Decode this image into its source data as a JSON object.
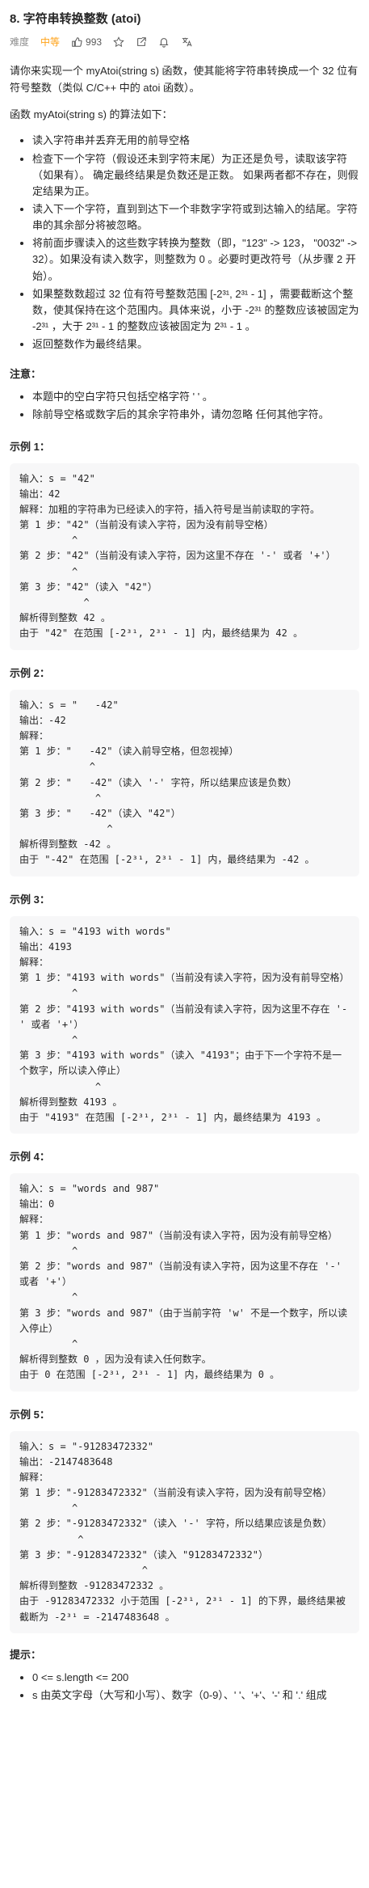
{
  "header": {
    "title": "8. 字符串转换整数 (atoi)",
    "difficulty_label": "难度",
    "difficulty": "中等",
    "likes": "993"
  },
  "intro": {
    "p1": "请你来实现一个 myAtoi(string s) 函数，使其能将字符串转换成一个 32 位有符号整数（类似 C/C++ 中的 atoi 函数）。",
    "p2": "函数 myAtoi(string s) 的算法如下：",
    "steps": [
      "读入字符串并丢弃无用的前导空格",
      "检查下一个字符（假设还未到字符末尾）为正还是负号，读取该字符（如果有）。 确定最终结果是负数还是正数。 如果两者都不存在，则假定结果为正。",
      "读入下一个字符，直到到达下一个非数字字符或到达输入的结尾。字符串的其余部分将被忽略。",
      "将前面步骤读入的这些数字转换为整数（即，\"123\" -> 123， \"0032\" -> 32）。如果没有读入数字，则整数为 0 。必要时更改符号（从步骤 2 开始）。",
      "如果整数数超过 32 位有符号整数范围 [-2³¹, 2³¹ - 1] ，需要截断这个整数，使其保持在这个范围内。具体来说，小于 -2³¹ 的整数应该被固定为 -2³¹ ，大于 2³¹ - 1 的整数应该被固定为 2³¹ - 1 。",
      "返回整数作为最终结果。"
    ]
  },
  "notes": {
    "heading": "注意：",
    "items": [
      "本题中的空白字符只包括空格字符 ' ' 。",
      "除前导空格或数字后的其余字符串外，请勿忽略 任何其他字符。"
    ]
  },
  "examples": [
    {
      "heading": "示例 1：",
      "lines": [
        "输入：s = \"42\"",
        "输出：42",
        "解释：加粗的字符串为已经读入的字符，插入符号是当前读取的字符。",
        "第 1 步：\"42\"（当前没有读入字符，因为没有前导空格）",
        "         ^",
        "第 2 步：\"42\"（当前没有读入字符，因为这里不存在 '-' 或者 '+'）",
        "         ^",
        "第 3 步：\"42\"（读入 \"42\"）",
        "           ^",
        "解析得到整数 42 。",
        "由于 \"42\" 在范围 [-2³¹, 2³¹ - 1] 内，最终结果为 42 。"
      ]
    },
    {
      "heading": "示例 2：",
      "lines": [
        "输入：s = \"   -42\"",
        "输出：-42",
        "解释：",
        "第 1 步：\"   -42\"（读入前导空格，但忽视掉）",
        "            ^",
        "第 2 步：\"   -42\"（读入 '-' 字符，所以结果应该是负数）",
        "             ^",
        "第 3 步：\"   -42\"（读入 \"42\"）",
        "               ^",
        "解析得到整数 -42 。",
        "由于 \"-42\" 在范围 [-2³¹, 2³¹ - 1] 内，最终结果为 -42 。"
      ]
    },
    {
      "heading": "示例 3：",
      "lines": [
        "输入：s = \"4193 with words\"",
        "输出：4193",
        "解释：",
        "第 1 步：\"4193 with words\"（当前没有读入字符，因为没有前导空格）",
        "         ^",
        "第 2 步：\"4193 with words\"（当前没有读入字符，因为这里不存在 '-' 或者 '+'）",
        "         ^",
        "第 3 步：\"4193 with words\"（读入 \"4193\"；由于下一个字符不是一个数字，所以读入停止）",
        "             ^",
        "解析得到整数 4193 。",
        "由于 \"4193\" 在范围 [-2³¹, 2³¹ - 1] 内，最终结果为 4193 。"
      ]
    },
    {
      "heading": "示例 4：",
      "lines": [
        "输入：s = \"words and 987\"",
        "输出：0",
        "解释：",
        "第 1 步：\"words and 987\"（当前没有读入字符，因为没有前导空格）",
        "         ^",
        "第 2 步：\"words and 987\"（当前没有读入字符，因为这里不存在 '-' 或者 '+'）",
        "         ^",
        "第 3 步：\"words and 987\"（由于当前字符 'w' 不是一个数字，所以读入停止）",
        "         ^",
        "解析得到整数 0 ，因为没有读入任何数字。",
        "由于 0 在范围 [-2³¹, 2³¹ - 1] 内，最终结果为 0 。"
      ]
    },
    {
      "heading": "示例 5：",
      "lines": [
        "输入：s = \"-91283472332\"",
        "输出：-2147483648",
        "解释：",
        "第 1 步：\"-91283472332\"（当前没有读入字符，因为没有前导空格）",
        "         ^",
        "第 2 步：\"-91283472332\"（读入 '-' 字符，所以结果应该是负数）",
        "          ^",
        "第 3 步：\"-91283472332\"（读入 \"91283472332\"）",
        "                     ^",
        "解析得到整数 -91283472332 。",
        "由于 -91283472332 小于范围 [-2³¹, 2³¹ - 1] 的下界，最终结果被截断为 -2³¹ = -2147483648 。"
      ]
    }
  ],
  "hints": {
    "heading": "提示：",
    "items": [
      "0 <= s.length <= 200",
      "s 由英文字母（大写和小写）、数字（0-9）、' '、'+'、'-' 和 '.' 组成"
    ]
  }
}
